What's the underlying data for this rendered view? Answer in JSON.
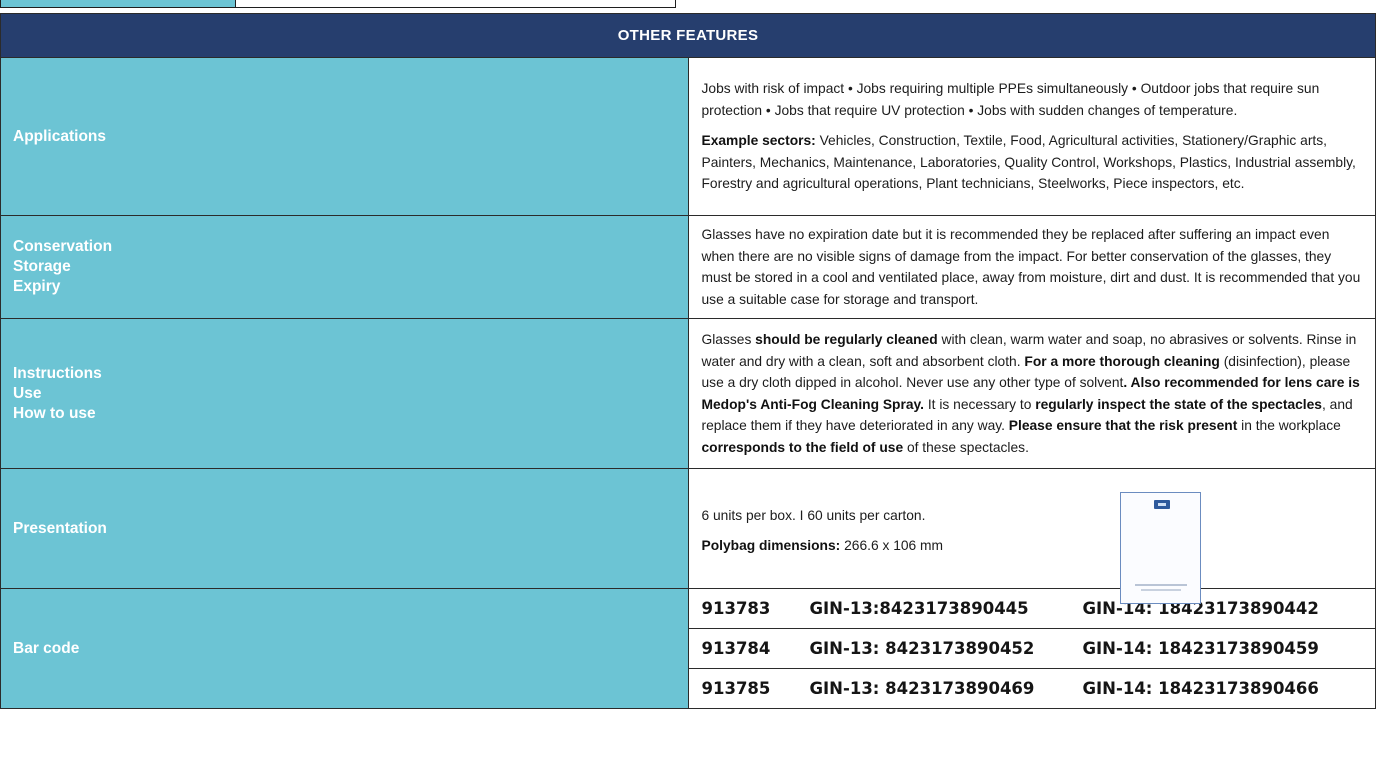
{
  "table": {
    "header": "OTHER FEATURES",
    "applications": {
      "label": "Applications",
      "text1": "Jobs with risk of impact • Jobs requiring multiple PPEs simultaneously • Outdoor jobs that require sun protection • Jobs that require UV protection • Jobs with sudden changes of temperature.",
      "sectors_label": "Example sectors:",
      "sectors_text": " Vehicles, Construction, Textile, Food, Agricultural activities, Stationery/Graphic arts, Painters, Mechanics, Maintenance, Laboratories, Quality Control, Workshops, Plastics, Industrial assembly, Forestry and agricultural operations, Plant technicians, Steelworks, Piece inspectors, etc."
    },
    "conservation": {
      "label_lines": [
        "Conservation",
        "Storage",
        "Expiry"
      ],
      "text": "Glasses have no expiration date but it is recommended they be replaced after suffering an impact even when there are no visible signs of damage from the impact. For better conservation of the glasses, they must be stored in a cool and ventilated place, away from moisture, dirt and dust. It is recommended that you use a suitable case for storage and transport."
    },
    "instructions": {
      "label_lines": [
        "Instructions",
        "Use",
        "How to use"
      ],
      "segments": [
        {
          "t": "Glasses ",
          "b": false
        },
        {
          "t": "should be regularly cleaned",
          "b": true
        },
        {
          "t": " with clean, warm water and soap, no abrasives or solvents. Rinse in water and dry with a clean, soft and absorbent cloth. ",
          "b": false
        },
        {
          "t": "For a more thorough cleaning",
          "b": true
        },
        {
          "t": " (disinfection), please use a dry cloth dipped in alcohol. Never use any other type of solvent",
          "b": false
        },
        {
          "t": ". Also recommended for lens care is Medop's Anti-Fog Cleaning Spray.",
          "b": true
        },
        {
          "t": " It is necessary to ",
          "b": false
        },
        {
          "t": "regularly inspect the state of the spectacles",
          "b": true
        },
        {
          "t": ", and replace them if they have deteriorated in any way. ",
          "b": false
        },
        {
          "t": "Please ensure that the risk present",
          "b": true
        },
        {
          "t": " in the workplace ",
          "b": false
        },
        {
          "t": "corresponds to the field of use",
          "b": true
        },
        {
          "t": " of these spectacles.",
          "b": false
        }
      ]
    },
    "presentation": {
      "label": "Presentation",
      "units": "6 units per box.  I  60 units per carton.",
      "polybag_label": "Polybag dimensions:",
      "polybag_value": " 266.6 x 106 mm"
    },
    "barcode": {
      "label": "Bar code",
      "rows": [
        {
          "code": "913783",
          "gin13": "GIN-13:8423173890445",
          "gin14": "GIN-14: 18423173890442"
        },
        {
          "code": "913784",
          "gin13": "GIN-13: 8423173890452",
          "gin14": "GIN-14: 18423173890459"
        },
        {
          "code": "913785",
          "gin13": "GIN-13: 8423173890469",
          "gin14": "GIN-14: 18423173890466"
        }
      ]
    }
  }
}
